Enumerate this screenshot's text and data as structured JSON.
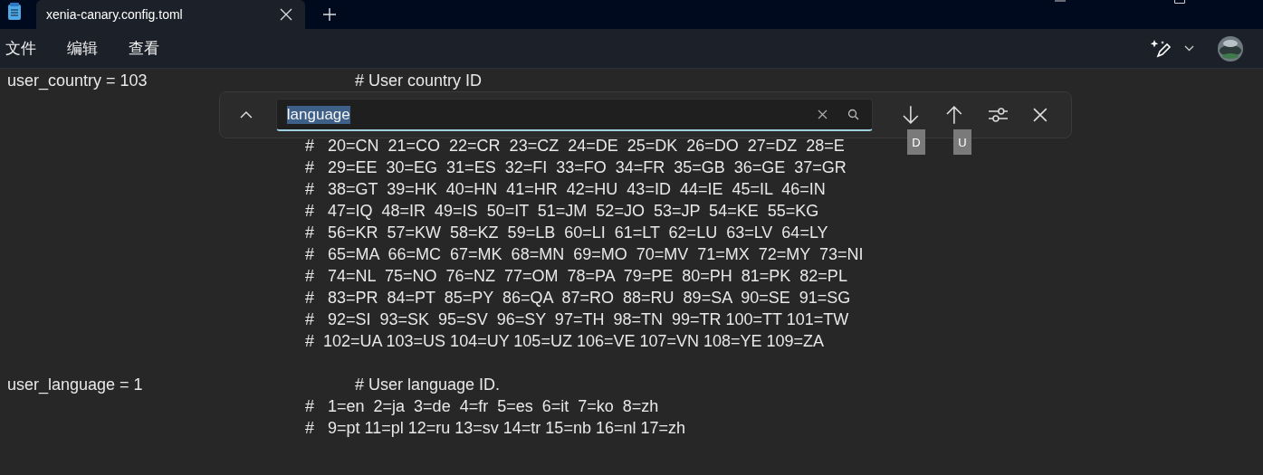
{
  "tab": {
    "title": "xenia-canary.config.toml",
    "selected": true
  },
  "menu": [
    "文件",
    "编辑",
    "查看"
  ],
  "find": {
    "value": "language",
    "tooltips": [
      "D",
      "U"
    ]
  },
  "lines": [
    {
      "kind": "setting",
      "key": "user_country = 103",
      "comment": "# User country ID"
    },
    {
      "kind": "hidden"
    },
    {
      "kind": "comment",
      "comment": "#   20=CN  21=CO  22=CR  23=CZ  24=DE  25=DK  26=DO  27=DZ  28=E"
    },
    {
      "kind": "comment",
      "comment": "#   29=EE  30=EG  31=ES  32=FI  33=FO  34=FR  35=GB  36=GE  37=GR"
    },
    {
      "kind": "comment",
      "comment": "#   38=GT  39=HK  40=HN  41=HR  42=HU  43=ID  44=IE  45=IL  46=IN"
    },
    {
      "kind": "comment",
      "comment": "#   47=IQ  48=IR  49=IS  50=IT  51=JM  52=JO  53=JP  54=KE  55=KG"
    },
    {
      "kind": "comment",
      "comment": "#   56=KR  57=KW  58=KZ  59=LB  60=LI  61=LT  62=LU  63=LV  64=LY"
    },
    {
      "kind": "comment",
      "comment": "#   65=MA  66=MC  67=MK  68=MN  69=MO  70=MV  71=MX  72=MY  73=NI"
    },
    {
      "kind": "comment",
      "comment": "#   74=NL  75=NO  76=NZ  77=OM  78=PA  79=PE  80=PH  81=PK  82=PL"
    },
    {
      "kind": "comment",
      "comment": "#   83=PR  84=PT  85=PY  86=QA  87=RO  88=RU  89=SA  90=SE  91=SG"
    },
    {
      "kind": "comment",
      "comment": "#   92=SI  93=SK  95=SV  96=SY  97=TH  98=TN  99=TR 100=TT 101=TW"
    },
    {
      "kind": "comment",
      "comment": "#  102=UA 103=US 104=UY 105=UZ 106=VE 107=VN 108=YE 109=ZA"
    },
    {
      "kind": "blank"
    },
    {
      "kind": "setting",
      "key": "user_language = 1",
      "comment": "# User language ID."
    },
    {
      "kind": "comment",
      "comment": "#   1=en  2=ja  3=de  4=fr  5=es  6=it  7=ko  8=zh"
    },
    {
      "kind": "comment",
      "comment": "#   9=pt 11=pl 12=ru 13=sv 14=tr 15=nb 16=nl 17=zh"
    }
  ]
}
